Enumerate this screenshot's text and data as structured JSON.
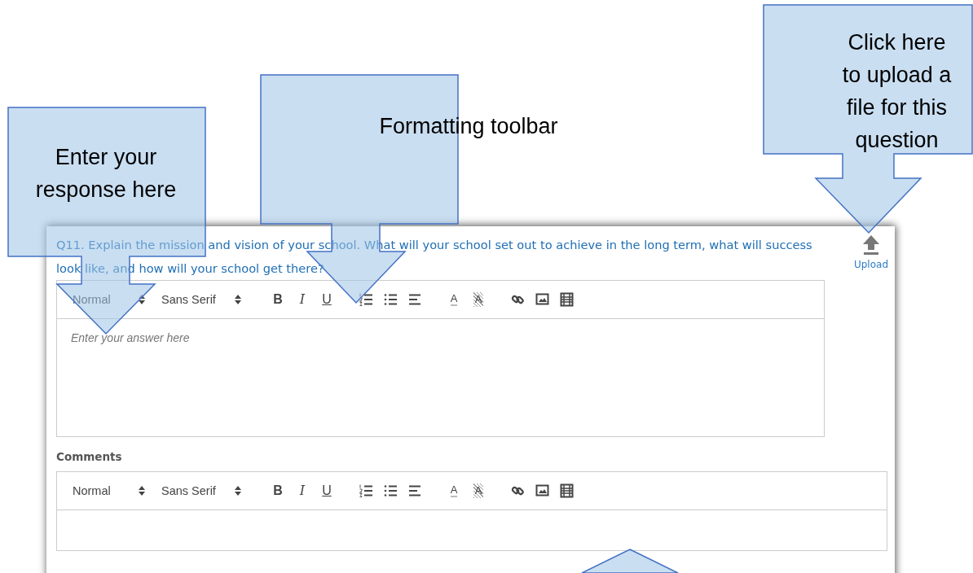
{
  "question": {
    "text": "Q11. Explain the mission and vision of your school. What will your school set out to achieve in the long term, what will success look like, and how will your school get there?"
  },
  "upload": {
    "label": "Upload"
  },
  "editors": [
    {
      "toolbar": {
        "header": "Normal",
        "font": "Sans Serif",
        "buttons": [
          {
            "kind": "bold",
            "label": "B"
          },
          {
            "kind": "italic",
            "label": "I"
          },
          {
            "kind": "underline",
            "label": "U"
          },
          {
            "kind": "ordered-list"
          },
          {
            "kind": "bullet-list"
          },
          {
            "kind": "align"
          },
          {
            "kind": "text-color",
            "label": "A"
          },
          {
            "kind": "background",
            "label": "A"
          },
          {
            "kind": "link"
          },
          {
            "kind": "image"
          },
          {
            "kind": "video"
          }
        ]
      },
      "placeholder": "Enter your answer here"
    },
    {
      "label": "Comments",
      "toolbar": {
        "header": "Normal",
        "font": "Sans Serif",
        "buttons": [
          {
            "kind": "bold",
            "label": "B"
          },
          {
            "kind": "italic",
            "label": "I"
          },
          {
            "kind": "underline",
            "label": "U"
          },
          {
            "kind": "ordered-list"
          },
          {
            "kind": "bullet-list"
          },
          {
            "kind": "align"
          },
          {
            "kind": "text-color",
            "label": "A"
          },
          {
            "kind": "background",
            "label": "A"
          },
          {
            "kind": "link"
          },
          {
            "kind": "image"
          },
          {
            "kind": "video"
          }
        ]
      }
    }
  ],
  "callouts": [
    {
      "kind": "callout",
      "text": "Enter your response here"
    },
    {
      "kind": "callout",
      "text": "Formatting toolbar"
    },
    {
      "kind": "callout",
      "text": "Click here to upload a file for this question"
    },
    {
      "kind": "arrow"
    }
  ]
}
